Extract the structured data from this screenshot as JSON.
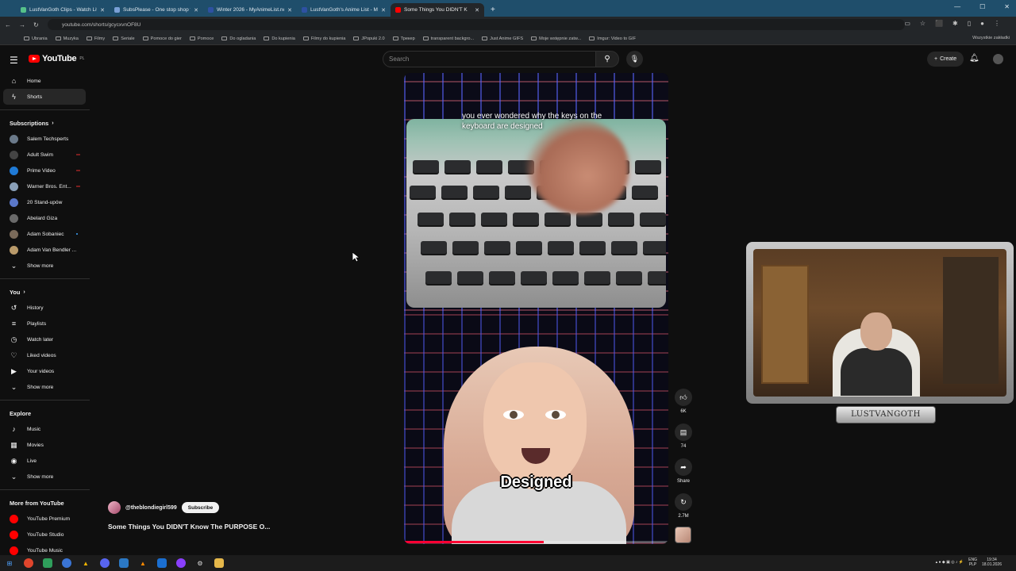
{
  "browser": {
    "tabs": [
      {
        "title": "LustVanGoth Clips - Watch Liv",
        "color": "#56c18a"
      },
      {
        "title": "SubsPlease - One stop shop fo",
        "color": "#7aa0d6"
      },
      {
        "title": "Winter 2026 - MyAnimeList.net",
        "color": "#2e51a2"
      },
      {
        "title": "LustVanGoth's Anime List - My",
        "color": "#2e51a2"
      },
      {
        "title": "Some Things You DIDN'T K",
        "color": "#ff0000",
        "active": true
      }
    ],
    "url": "youtube.com/shorts/gcycxvnOF8U",
    "bookmarks": [
      "Ubrania",
      "Muzyka",
      "Filmy",
      "Seriale",
      "Pomoce do gier",
      "Pomoce",
      "Do ogladania",
      "Do kupienia",
      "Filmy do kupienia",
      "JPopuki 2.0",
      "Трекер",
      "transparent backgro...",
      "Just Anime GIFS",
      "Moje wstępnie zatw...",
      "Imgur: Video to GIF"
    ],
    "bookmarks_right": "Wszystkie zakładki"
  },
  "youtube": {
    "logo_text": "YouTube",
    "region": "PL",
    "search_placeholder": "Search",
    "create_label": "Create"
  },
  "sidebar": {
    "main": [
      {
        "label": "Home",
        "icon": "home-icon",
        "glyph": "⌂"
      },
      {
        "label": "Shorts",
        "icon": "shorts-icon",
        "glyph": "ϟ",
        "active": true
      }
    ],
    "subscriptions_header": "Subscriptions",
    "subscriptions": [
      {
        "label": "Salem Techsperts",
        "color": "#6b7a8a"
      },
      {
        "label": "Adult Swim",
        "color": "#444444",
        "live": true
      },
      {
        "label": "Prime Video",
        "color": "#1f7ad6",
        "live": true
      },
      {
        "label": "Warner Bros. Ent...",
        "color": "#8aa0b8",
        "live": true
      },
      {
        "label": "20 Stand-upów",
        "color": "#5b78c9"
      },
      {
        "label": "Abelard Giza",
        "color": "#6a6a6a"
      },
      {
        "label": "Adam Sobaniec",
        "color": "#7a6a5a",
        "dot": true
      },
      {
        "label": "Adam Van Bendler ...",
        "color": "#b99a6a"
      }
    ],
    "show_more": "Show more",
    "you_header": "You",
    "you": [
      {
        "label": "History",
        "glyph": "↺"
      },
      {
        "label": "Playlists",
        "glyph": "≡"
      },
      {
        "label": "Watch later",
        "glyph": "◷"
      },
      {
        "label": "Liked videos",
        "glyph": "♡"
      },
      {
        "label": "Your videos",
        "glyph": "▶"
      }
    ],
    "explore_header": "Explore",
    "explore": [
      {
        "label": "Music",
        "glyph": "♪"
      },
      {
        "label": "Movies",
        "glyph": "▦"
      },
      {
        "label": "Live",
        "glyph": "◉"
      }
    ],
    "more_header": "More from YouTube",
    "more": [
      {
        "label": "YouTube Premium"
      },
      {
        "label": "YouTube Studio"
      },
      {
        "label": "YouTube Music"
      }
    ]
  },
  "short": {
    "caption_top": "you ever wondered why the keys on the keyboard are designed",
    "caption_big": "Designed",
    "progress": 0.53,
    "channel": "@theblondiegirl599",
    "subscribe": "Subscribe",
    "title": "Some Things You DIDN'T Know The PURPOSE O...",
    "likes": "6K",
    "comments": "74",
    "share": "Share",
    "remix": "2.7M"
  },
  "webcam": {
    "banner": "LUSTVANGOTH"
  },
  "taskbar": {
    "lang": "ENG",
    "lang2": "PLP",
    "time": "19:34",
    "date": "18.01.2026"
  }
}
